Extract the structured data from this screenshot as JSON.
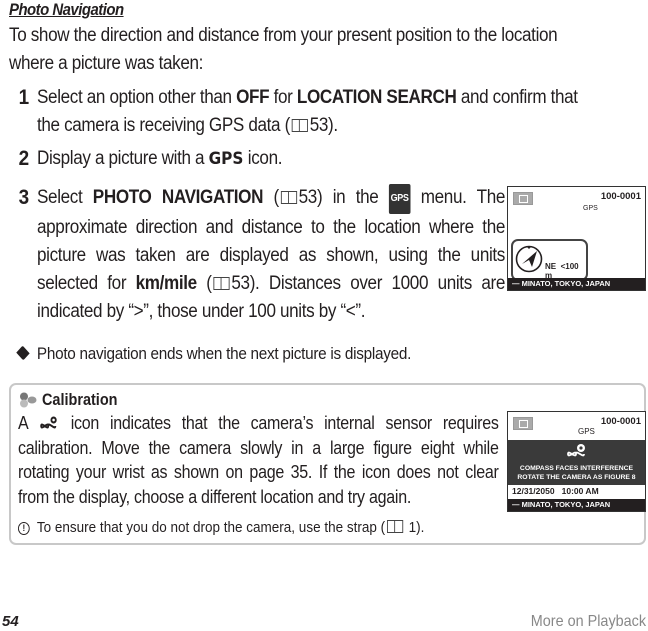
{
  "section": {
    "title": "Photo Navigation",
    "intro_line1": "To show the direction and distance from your present position to the location",
    "intro_line2": "where a picture was taken:"
  },
  "steps": [
    {
      "num": "1",
      "pre": "Select an option other than ",
      "bold1": "OFF",
      "mid": " for ",
      "bold2": "LOCATION SEARCH",
      "post": " and confirm that",
      "line2": "the camera is receiving GPS data (",
      "ref": "53",
      "line2_end": ")."
    },
    {
      "num": "2",
      "pre": "Display a picture with a ",
      "icon_label": "GPS",
      "post": " icon."
    },
    {
      "num": "3",
      "pre": "Select ",
      "bold1": "PHOTO NAVIGATION",
      "ref1": "53",
      "mid": ") in the ",
      "menu_icon": "GPS",
      "mid2": " menu. The approximate direction and distance to the location where the picture was taken are displayed as shown, using the units selected for ",
      "bold2": "km/mile",
      "ref2": "53",
      "post": "). Distances over 1000 units are indicated by “>”, those under 100 units by “<”."
    }
  ],
  "screen1": {
    "file_number": "100-0001",
    "gps_label": "GPS",
    "direction": "NE",
    "distance": "<100 m",
    "location": "— MINATO, TOKYO, JAPAN"
  },
  "note": {
    "icon": "tag-icon",
    "text": "Photo navigation ends when the next picture is displayed."
  },
  "calibration": {
    "title": "Calibration",
    "text_a": "A ",
    "text_b": " icon indicates that the camera’s internal sensor requires calibration. Move the camera slowly in a large figure eight while rotating your wrist as shown on page 35. If the icon does not clear from the display, choose a different location and try again.",
    "caution_icon": "caution-icon",
    "caution_text": "To ensure that you do not drop the camera, use the strap (",
    "caution_ref": "1",
    "caution_end": ")."
  },
  "screen2": {
    "file_number": "100-0001",
    "gps_label": "GPS",
    "message_line1": "COMPASS FACES INTERFERENCE",
    "message_line2": "ROTATE THE CAMERA AS FIGURE 8",
    "date": "12/31/2050",
    "time": "10:00  AM",
    "location": "— MINATO, TOKYO, JAPAN"
  },
  "footer": {
    "page_number": "54",
    "section_name": "More on Playback"
  }
}
